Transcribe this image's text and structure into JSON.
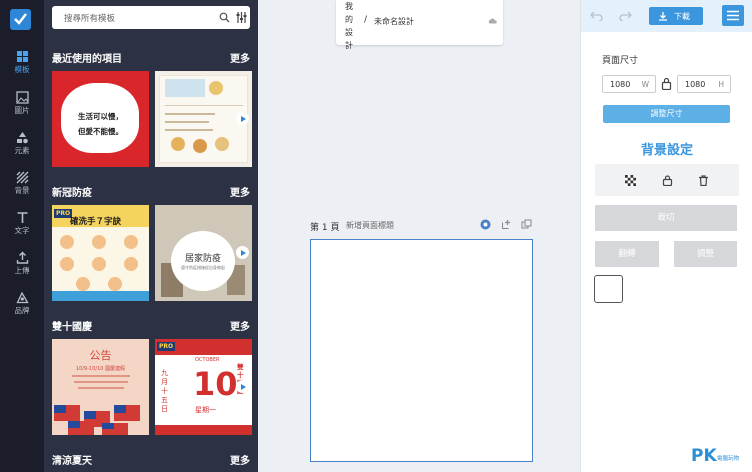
{
  "rail": {
    "items": [
      {
        "label": "模板",
        "icon": "template-icon"
      },
      {
        "label": "圖片",
        "icon": "image-icon"
      },
      {
        "label": "元素",
        "icon": "elements-icon"
      },
      {
        "label": "背景",
        "icon": "background-icon"
      },
      {
        "label": "文字",
        "icon": "text-icon"
      },
      {
        "label": "上傳",
        "icon": "upload-icon"
      },
      {
        "label": "品牌",
        "icon": "brand-icon"
      }
    ]
  },
  "panel": {
    "search_placeholder": "搜尋所有模板",
    "sections": [
      {
        "title": "最近使用的項目",
        "more": "更多",
        "templates": [
          {
            "lines": [
              "生活可以慢，",
              "但愛不能慢。"
            ]
          },
          {
            "lines": []
          }
        ]
      },
      {
        "title": "新冠防疫",
        "more": "更多",
        "templates": [
          {
            "badge": "PRO",
            "lines": [
              "確洗手７字訣"
            ]
          },
          {
            "lines": [
              "居家防疫",
              "遵守防疫措施從自身做起"
            ]
          }
        ]
      },
      {
        "title": "雙十國慶",
        "more": "更多",
        "templates": [
          {
            "lines": [
              "公告",
              "10/9-10/10 國慶連假"
            ]
          },
          {
            "badge": "PRO",
            "lines": [
              "OCTOBER",
              "10",
              "九月十五日",
              "星期一",
              "雙十國慶"
            ]
          }
        ]
      },
      {
        "title": "清涼夏天",
        "more": "更多",
        "templates": []
      }
    ]
  },
  "doc": {
    "breadcrumb_root": "我的設計",
    "separator": "/",
    "name": "未命名設計"
  },
  "canvas": {
    "page_label": "第 1 頁",
    "page_title_placeholder": "新增頁面標題"
  },
  "right": {
    "download_label": "下載",
    "size_title": "頁面尺寸",
    "width_value": "1080",
    "width_unit": "W",
    "height_value": "1080",
    "height_unit": "H",
    "resize_label": "調整尺寸",
    "bg_title": "背景設定",
    "crop_label": "裁切",
    "flip_label": "翻轉",
    "adjust_label": "調整",
    "accent_color": "#3c96de"
  },
  "watermark": {
    "text": "PK",
    "sub": "電腦玩物"
  }
}
